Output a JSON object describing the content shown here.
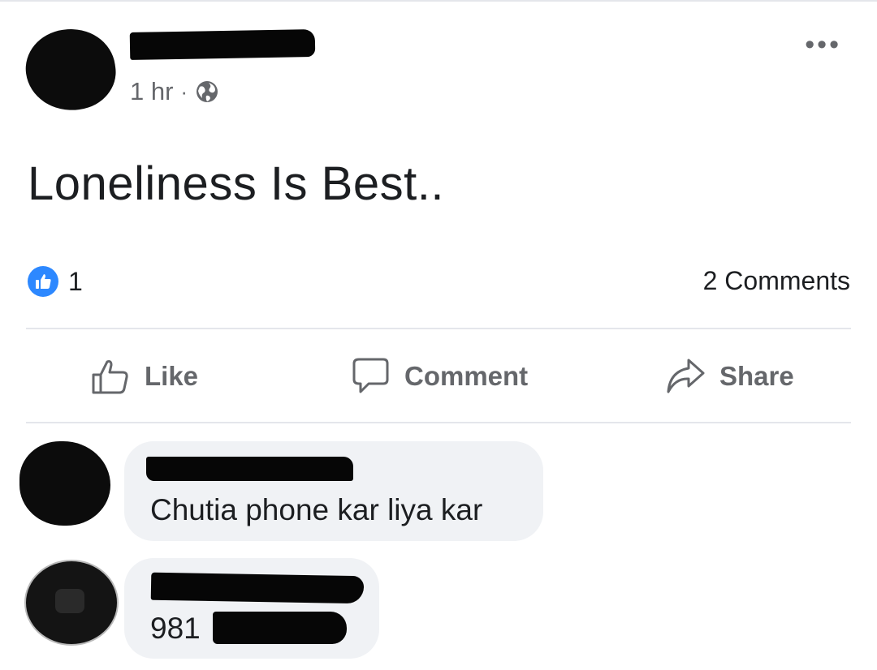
{
  "post": {
    "time": "1 hr",
    "separator": "·",
    "privacy_icon": "globe-icon",
    "more_icon": "more-icon",
    "more_label": "•••",
    "text": "Loneliness Is Best.."
  },
  "reactions": {
    "icon": "like-reaction-icon",
    "count": "1",
    "comments_count": "2 Comments"
  },
  "actions": {
    "like_label": "Like",
    "comment_label": "Comment",
    "share_label": "Share"
  },
  "comments": [
    {
      "text": "Chutia phone kar liya kar"
    },
    {
      "text": "981"
    }
  ],
  "colors": {
    "accent": "#2d88ff",
    "bubble": "#f0f2f5",
    "secondary_text": "#65676b",
    "divider": "#e4e6eb"
  }
}
